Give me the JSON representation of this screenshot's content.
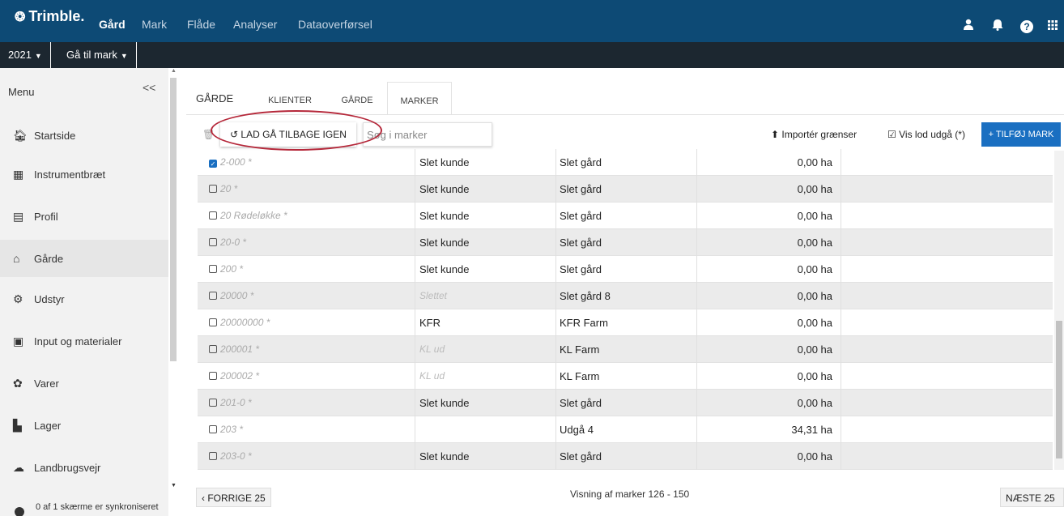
{
  "topnav": {
    "brand": "Trimble.",
    "items": [
      "Gård",
      "Mark",
      "Flåde",
      "Analyser",
      "Dataoverførsel"
    ]
  },
  "subbar": {
    "year": "2021",
    "goto": "Gå til mark"
  },
  "sidebar": {
    "menu_label": "Menu",
    "collapse": "<<",
    "items": [
      {
        "label": "Startside",
        "icon": "home-icon"
      },
      {
        "label": "Instrumentbræt",
        "icon": "dashboard-icon"
      },
      {
        "label": "Profil",
        "icon": "profile-icon"
      },
      {
        "label": "Gårde",
        "icon": "farms-icon"
      },
      {
        "label": "Udstyr",
        "icon": "equipment-icon"
      },
      {
        "label": "Input og materialer",
        "icon": "inputs-icon"
      },
      {
        "label": "Varer",
        "icon": "crops-icon"
      },
      {
        "label": "Lager",
        "icon": "storage-icon"
      },
      {
        "label": "Landbrugsvejr",
        "icon": "weather-icon"
      }
    ],
    "sync_status": "0 af 1 skærme er synkroniseret"
  },
  "main": {
    "page_title": "GÅRDE",
    "tabs": [
      "KLIENTER",
      "GÅRDE",
      "MARKER"
    ],
    "active_tab": "MARKER",
    "undo_label": "LAD GÅ TILBAGE IGEN",
    "search_placeholder": "Søg i marker",
    "import_label": "Importér grænser",
    "show_label": "Vis lod udgå (*)",
    "add_label": "TILFØJ MARK"
  },
  "table": {
    "rows": [
      {
        "name": "2-000 *",
        "client": "Slet kunde",
        "farm": "Slet gård",
        "area": "0,00 ha",
        "checked": true
      },
      {
        "name": "20 *",
        "client": "Slet kunde",
        "farm": "Slet gård",
        "area": "0,00 ha",
        "checked": false
      },
      {
        "name": "20 Rødeløkke *",
        "client": "Slet kunde",
        "farm": "Slet gård",
        "area": "0,00 ha",
        "checked": false
      },
      {
        "name": "20-0 *",
        "client": "Slet kunde",
        "farm": "Slet gård",
        "area": "0,00 ha",
        "checked": false
      },
      {
        "name": "200 *",
        "client": "Slet kunde",
        "farm": "Slet gård",
        "area": "0,00 ha",
        "checked": false
      },
      {
        "name": "20000 *",
        "client": "Slettet",
        "farm": "Slet gård 8",
        "area": "0,00 ha",
        "checked": false
      },
      {
        "name": "20000000 *",
        "client": "KFR",
        "farm": "KFR Farm",
        "area": "0,00 ha",
        "checked": false
      },
      {
        "name": "200001 *",
        "client": "KL ud",
        "farm": "KL Farm",
        "area": "0,00 ha",
        "checked": false
      },
      {
        "name": "200002 *",
        "client": "KL ud",
        "farm": "KL Farm",
        "area": "0,00 ha",
        "checked": false
      },
      {
        "name": "201-0 *",
        "client": "Slet kunde",
        "farm": "Slet gård",
        "area": "0,00 ha",
        "checked": false
      },
      {
        "name": "203 *",
        "client": "",
        "farm": "Udgå 4",
        "area": "34,31 ha",
        "checked": false
      },
      {
        "name": "203-0 *",
        "client": "Slet kunde",
        "farm": "Slet gård",
        "area": "0,00 ha",
        "checked": false
      }
    ]
  },
  "footer": {
    "prev": "FORRIGE 25",
    "next": "NÆSTE 25",
    "info": "Visning af marker 126 - 150"
  }
}
